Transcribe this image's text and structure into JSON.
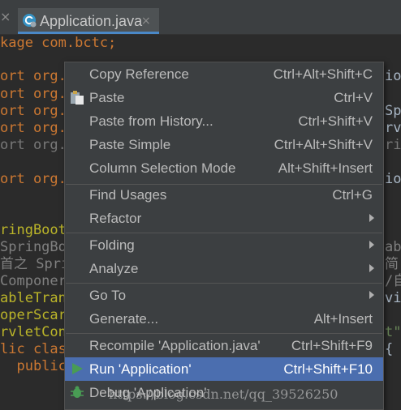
{
  "tabs": {
    "prev_close": "×",
    "active_title": "Application.java",
    "active_close": "×",
    "active_icon": "java-class-icon"
  },
  "code_lines": [
    {
      "text": "kage com.bctc;"
    },
    {
      "text": "ort org."
    },
    {
      "text": "ort org."
    },
    {
      "text": "ort org."
    },
    {
      "text": "ort org."
    },
    {
      "text": "ort org."
    },
    {
      "text": "ort org."
    },
    {
      "text": "ringBoot"
    },
    {
      "text": "SpringBo"
    },
    {
      "text": "首之 Spri"
    },
    {
      "text": "Componer"
    },
    {
      "text": "ableTran"
    },
    {
      "text": "operScar"
    },
    {
      "text": "rvletCon"
    },
    {
      "text": "lic clas"
    },
    {
      "text": "  public"
    }
  ],
  "code_right_fragments": [
    {
      "text": "ion;"
    },
    {
      "text": "Spr"
    },
    {
      "text": "rvl"
    },
    {
      "text": "ri"
    },
    {
      "text": "io"
    },
    {
      "text": "ab"
    },
    {
      "text": "简"
    },
    {
      "text": "/自"
    },
    {
      "text": "vic"
    },
    {
      "text": "t\""
    },
    {
      "text": "{"
    }
  ],
  "context_menu": {
    "items": [
      {
        "label": "Copy Reference",
        "shortcut": "Ctrl+Alt+Shift+C"
      },
      {
        "label": "Paste",
        "shortcut": "Ctrl+V",
        "icon": "paste-icon"
      },
      {
        "label": "Paste from History...",
        "shortcut": "Ctrl+Shift+V"
      },
      {
        "label": "Paste Simple",
        "shortcut": "Ctrl+Alt+Shift+V"
      },
      {
        "label": "Column Selection Mode",
        "shortcut": "Alt+Shift+Insert"
      },
      {
        "label": "Find Usages",
        "shortcut": "Ctrl+G"
      },
      {
        "label": "Refactor",
        "shortcut": ""
      },
      {
        "label": "Folding",
        "shortcut": ""
      },
      {
        "label": "Analyze",
        "shortcut": ""
      },
      {
        "label": "Go To",
        "shortcut": ""
      },
      {
        "label": "Generate...",
        "shortcut": "Alt+Insert"
      },
      {
        "label": "Recompile 'Application.java'",
        "shortcut": "Ctrl+Shift+F9"
      },
      {
        "label": "Run 'Application'",
        "shortcut": "Ctrl+Shift+F10",
        "icon": "run-icon",
        "selected": true
      },
      {
        "label": "Debug 'Application'",
        "shortcut": "",
        "icon": "debug-icon"
      }
    ]
  },
  "watermark": "https://blog.csdn.net/qq_39526250",
  "colors": {
    "editor_bg": "#2b2b2b",
    "menu_bg": "#3c3f41",
    "selection": "#4b6eaf",
    "keyword": "#cc7832",
    "annotation": "#bbb529",
    "run_green": "#499c54"
  }
}
